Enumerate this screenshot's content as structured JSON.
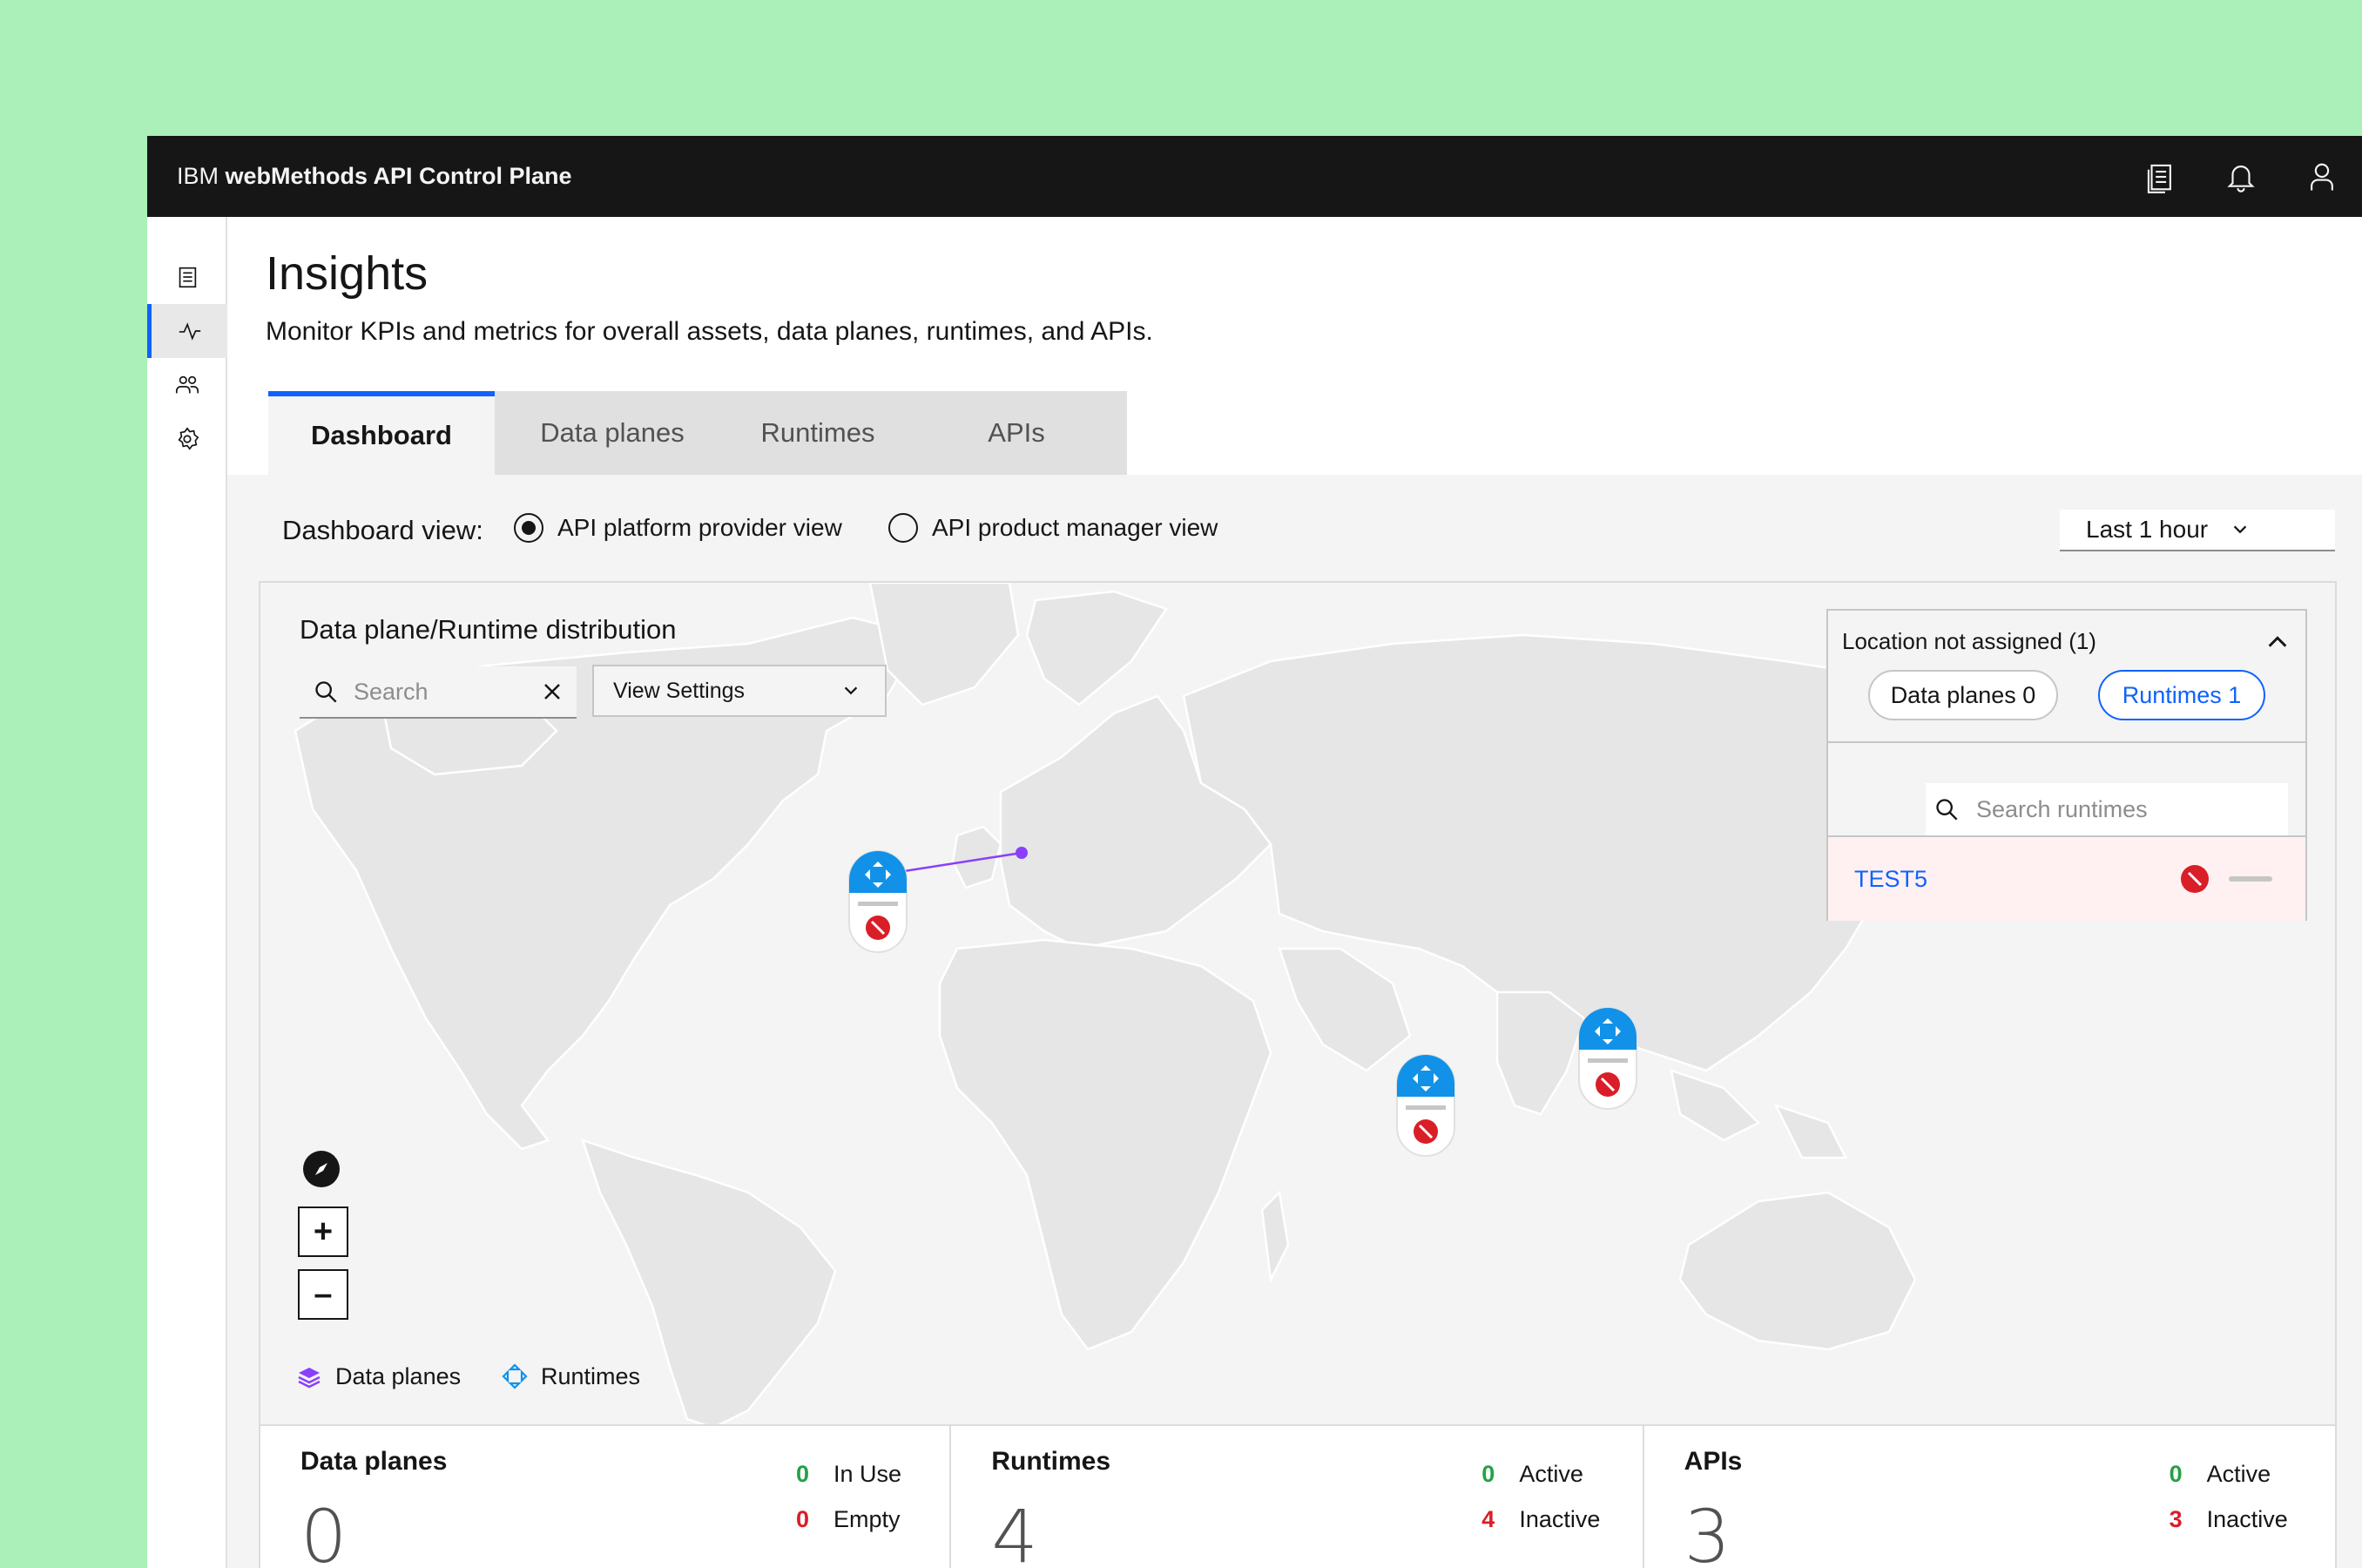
{
  "header": {
    "brand_prefix": "IBM",
    "brand_name": "webMethods API Control Plane",
    "icons": [
      "documentation-icon",
      "notification-icon",
      "user-icon"
    ]
  },
  "sidenav": {
    "items": [
      {
        "icon": "catalog-icon",
        "active": false
      },
      {
        "icon": "activity-icon",
        "active": true
      },
      {
        "icon": "users-icon",
        "active": false
      },
      {
        "icon": "settings-icon",
        "active": false
      }
    ]
  },
  "page": {
    "title": "Insights",
    "description": "Monitor KPIs and metrics for overall assets, data planes, runtimes, and APIs."
  },
  "tabs": [
    {
      "label": "Dashboard",
      "active": true
    },
    {
      "label": "Data planes",
      "active": false
    },
    {
      "label": "Runtimes",
      "active": false
    },
    {
      "label": "APIs",
      "active": false
    }
  ],
  "dashboard_view": {
    "label": "Dashboard view:",
    "options": [
      {
        "label": "API platform provider view",
        "selected": true
      },
      {
        "label": "API product manager view",
        "selected": false
      }
    ]
  },
  "time_range": {
    "selected": "Last 1 hour"
  },
  "map": {
    "title": "Data plane/Runtime distribution",
    "search_placeholder": "Search",
    "view_settings_label": "View Settings",
    "zoom_in": "+",
    "zoom_out": "–",
    "legend": [
      {
        "label": "Data planes",
        "icon": "data-planes-icon",
        "color": "#8a3ffc"
      },
      {
        "label": "Runtimes",
        "icon": "runtimes-icon",
        "color": "#1192e8"
      }
    ],
    "accent_colors": {
      "runtime": "#1192e8",
      "stopped": "#da1e28",
      "connection": "#8a3ffc"
    }
  },
  "location_panel": {
    "title": "Location not assigned (1)",
    "data_planes_pill": "Data planes 0",
    "runtimes_pill": "Runtimes 1",
    "search_placeholder": "Search runtimes",
    "rows": [
      {
        "name": "TEST5",
        "status": "stopped"
      }
    ]
  },
  "kpis": [
    {
      "title": "Data planes",
      "total": "0",
      "stats": [
        {
          "count": "0",
          "label": "In Use",
          "color": "green"
        },
        {
          "count": "0",
          "label": "Empty",
          "color": "red"
        }
      ]
    },
    {
      "title": "Runtimes",
      "total": "4",
      "stats": [
        {
          "count": "0",
          "label": "Active",
          "color": "green"
        },
        {
          "count": "4",
          "label": "Inactive",
          "color": "red"
        }
      ]
    },
    {
      "title": "APIs",
      "total": "3",
      "stats": [
        {
          "count": "0",
          "label": "Active",
          "color": "green"
        },
        {
          "count": "3",
          "label": "Inactive",
          "color": "red"
        }
      ]
    }
  ]
}
